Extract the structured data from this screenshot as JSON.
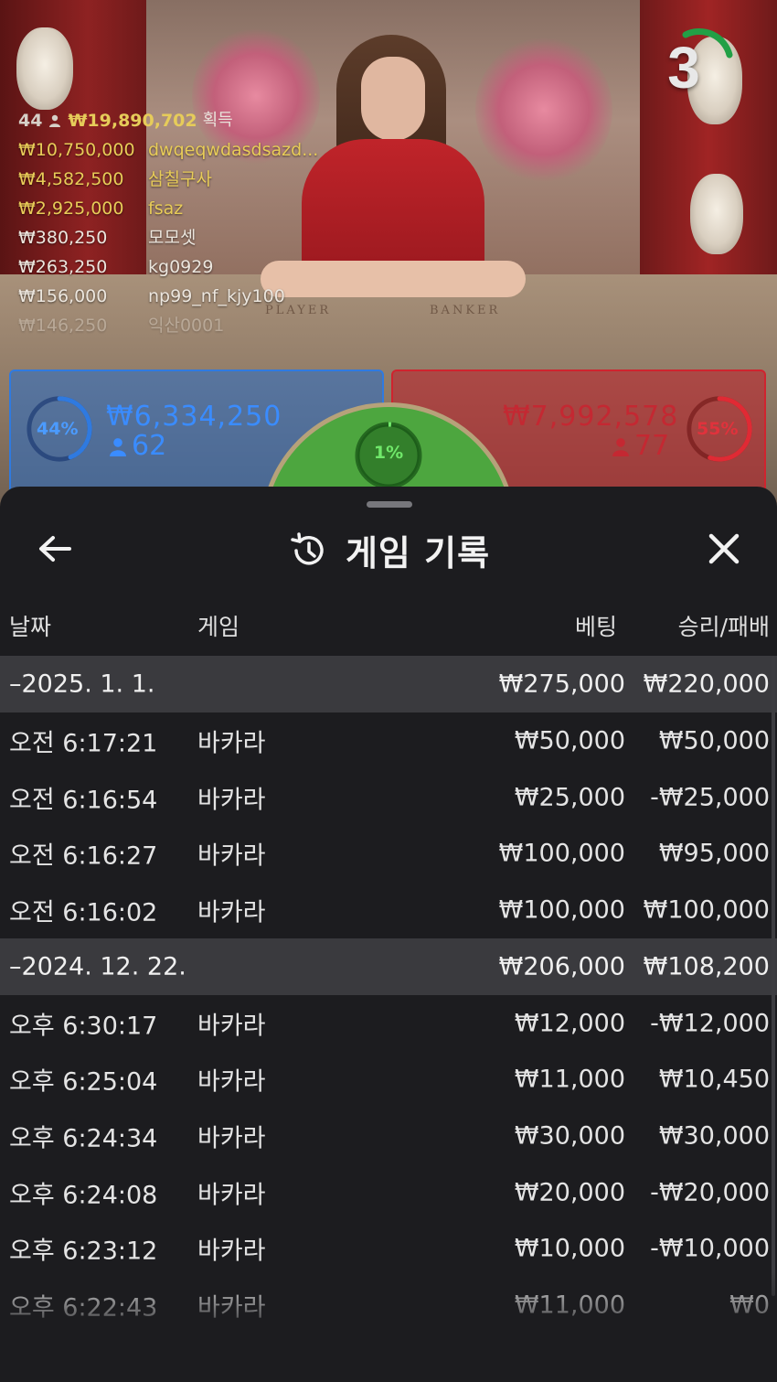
{
  "countdown": {
    "value": "3",
    "color": "#22a046"
  },
  "winners": {
    "head": {
      "count": "44",
      "amount": "₩19,890,702",
      "label": "획득"
    },
    "list": [
      {
        "amount": "₩10,750,000",
        "name": "dwqeqwdasdsazd...",
        "color": "gold"
      },
      {
        "amount": "₩4,582,500",
        "name": "삼칠구사",
        "color": "gold"
      },
      {
        "amount": "₩2,925,000",
        "name": "fsaz",
        "color": "gold"
      },
      {
        "amount": "₩380,250",
        "name": "모모셋",
        "color": "white"
      },
      {
        "amount": "₩263,250",
        "name": "kg0929",
        "color": "white"
      },
      {
        "amount": "₩156,000",
        "name": "np99_nf_kjy100",
        "color": "white"
      },
      {
        "amount": "₩146,250",
        "name": "익산0001",
        "color": "white"
      }
    ]
  },
  "table_felt": {
    "player": "PLAYER",
    "banker": "BANKER"
  },
  "bets": {
    "player": {
      "percent": "44%",
      "amount": "₩6,334,250",
      "count": "62",
      "fill": 0.44,
      "color": "#2f7ae0"
    },
    "banker": {
      "percent": "55%",
      "amount": "₩7,992,578",
      "count": "77",
      "fill": 0.55,
      "color": "#d0232e"
    },
    "tie": {
      "percent": "1%",
      "fill": 0.01
    }
  },
  "history": {
    "title": "게임 기록",
    "columns": {
      "date": "날짜",
      "game": "게임",
      "bet": "베팅",
      "result": "승리/패배"
    },
    "groups": [
      {
        "date": "–2025. 1. 1.",
        "bet_total": "₩275,000",
        "result_total": "₩220,000",
        "rows": [
          {
            "time": "오전 6:17:21",
            "game": "바카라",
            "bet": "₩50,000",
            "result": "₩50,000"
          },
          {
            "time": "오전 6:16:54",
            "game": "바카라",
            "bet": "₩25,000",
            "result": "-₩25,000"
          },
          {
            "time": "오전 6:16:27",
            "game": "바카라",
            "bet": "₩100,000",
            "result": "₩95,000"
          },
          {
            "time": "오전 6:16:02",
            "game": "바카라",
            "bet": "₩100,000",
            "result": "₩100,000"
          }
        ]
      },
      {
        "date": "–2024. 12. 22.",
        "bet_total": "₩206,000",
        "result_total": "₩108,200",
        "rows": [
          {
            "time": "오후 6:30:17",
            "game": "바카라",
            "bet": "₩12,000",
            "result": "-₩12,000"
          },
          {
            "time": "오후 6:25:04",
            "game": "바카라",
            "bet": "₩11,000",
            "result": "₩10,450"
          },
          {
            "time": "오후 6:24:34",
            "game": "바카라",
            "bet": "₩30,000",
            "result": "₩30,000"
          },
          {
            "time": "오후 6:24:08",
            "game": "바카라",
            "bet": "₩20,000",
            "result": "-₩20,000"
          },
          {
            "time": "오후 6:23:12",
            "game": "바카라",
            "bet": "₩10,000",
            "result": "-₩10,000"
          },
          {
            "time": "오후 6:22:43",
            "game": "바카라",
            "bet": "₩11,000",
            "result": "₩0"
          }
        ]
      }
    ]
  },
  "icons": {
    "back": "arrow-left-icon",
    "history": "history-clock-icon",
    "close": "close-icon"
  }
}
